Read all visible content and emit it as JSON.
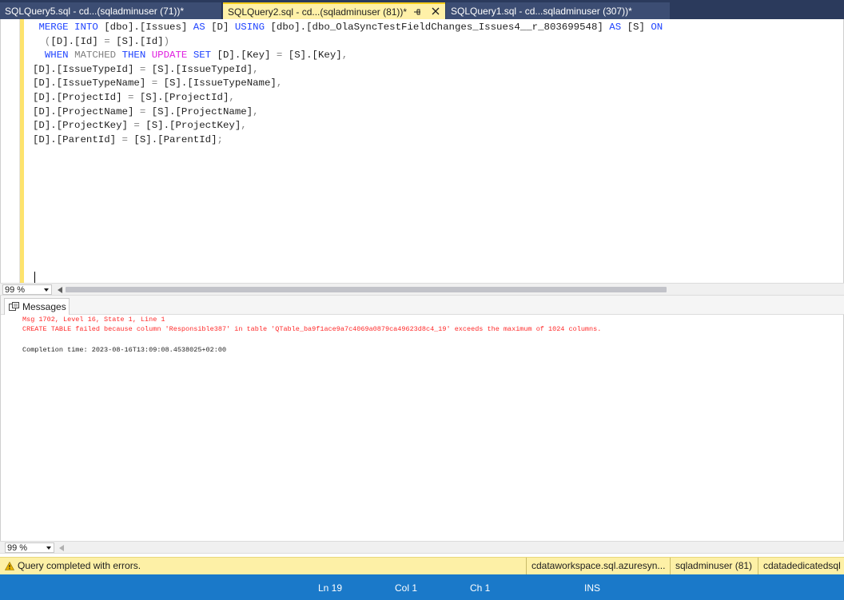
{
  "tabs": [
    {
      "label": "SQLQuery5.sql - cd...(sqladminuser (71))*"
    },
    {
      "label": "SQLQuery2.sql - cd...(sqladminuser (81))*",
      "active": true
    },
    {
      "label": "SQLQuery1.sql - cd...sqladminuser (307))*"
    }
  ],
  "editor": {
    "lines": [
      [
        {
          "t": " ",
          "c": ""
        },
        {
          "t": "MERGE INTO",
          "c": "kw"
        },
        {
          "t": " [dbo].[Issues] ",
          "c": ""
        },
        {
          "t": "AS",
          "c": "kw"
        },
        {
          "t": " [D] ",
          "c": ""
        },
        {
          "t": "USING",
          "c": "kw"
        },
        {
          "t": " [dbo].[dbo_OlaSyncTestFieldChanges_Issues4__r_803699548] ",
          "c": ""
        },
        {
          "t": "AS",
          "c": "kw"
        },
        {
          "t": " [S] ",
          "c": ""
        },
        {
          "t": "ON",
          "c": "kw"
        }
      ],
      [
        {
          "t": "  ",
          "c": ""
        },
        {
          "t": "(",
          "c": "gy"
        },
        {
          "t": "[D].[Id] ",
          "c": ""
        },
        {
          "t": "=",
          "c": "gy"
        },
        {
          "t": " [S].[Id]",
          "c": ""
        },
        {
          "t": ")",
          "c": "gy"
        }
      ],
      [
        {
          "t": "  ",
          "c": ""
        },
        {
          "t": "WHEN",
          "c": "kw"
        },
        {
          "t": " ",
          "c": ""
        },
        {
          "t": "MATCHED",
          "c": "gy"
        },
        {
          "t": " ",
          "c": ""
        },
        {
          "t": "THEN",
          "c": "kw"
        },
        {
          "t": " ",
          "c": ""
        },
        {
          "t": "UPDATE",
          "c": "pk"
        },
        {
          "t": " ",
          "c": ""
        },
        {
          "t": "SET",
          "c": "kw"
        },
        {
          "t": " [D].[Key] ",
          "c": ""
        },
        {
          "t": "=",
          "c": "gy"
        },
        {
          "t": " [S].[Key]",
          "c": ""
        },
        {
          "t": ",",
          "c": "gy"
        }
      ],
      [
        {
          "t": "[D].[IssueTypeId] ",
          "c": ""
        },
        {
          "t": "=",
          "c": "gy"
        },
        {
          "t": " [S].[IssueTypeId]",
          "c": ""
        },
        {
          "t": ",",
          "c": "gy"
        }
      ],
      [
        {
          "t": "[D].[IssueTypeName] ",
          "c": ""
        },
        {
          "t": "=",
          "c": "gy"
        },
        {
          "t": " [S].[IssueTypeName]",
          "c": ""
        },
        {
          "t": ",",
          "c": "gy"
        }
      ],
      [
        {
          "t": "[D].[ProjectId] ",
          "c": ""
        },
        {
          "t": "=",
          "c": "gy"
        },
        {
          "t": " [S].[ProjectId]",
          "c": ""
        },
        {
          "t": ",",
          "c": "gy"
        }
      ],
      [
        {
          "t": "[D].[ProjectName] ",
          "c": ""
        },
        {
          "t": "=",
          "c": "gy"
        },
        {
          "t": " [S].[ProjectName]",
          "c": ""
        },
        {
          "t": ",",
          "c": "gy"
        }
      ],
      [
        {
          "t": "[D].[ProjectKey] ",
          "c": ""
        },
        {
          "t": "=",
          "c": "gy"
        },
        {
          "t": " [S].[ProjectKey]",
          "c": ""
        },
        {
          "t": ",",
          "c": "gy"
        }
      ],
      [
        {
          "t": "[D].[ParentId] ",
          "c": ""
        },
        {
          "t": "=",
          "c": "gy"
        },
        {
          "t": " [S].[ParentId]",
          "c": ""
        },
        {
          "t": ";",
          "c": "gy"
        }
      ]
    ],
    "zoom": "99 %"
  },
  "results": {
    "tab_label": "Messages",
    "zoom": "99 %",
    "messages": {
      "line1": "Msg 1702, Level 16, State 1, Line 1",
      "line2": "CREATE TABLE failed because column 'Responsible387' in table 'QTable_ba9f1ace9a7c4069a0879ca49623d8c4_19' exceeds the maximum of 1024 columns.",
      "completion": "Completion time: 2023-08-16T13:09:08.4538025+02:00"
    }
  },
  "query_status": {
    "text": "Query completed with errors.",
    "server": "cdataworkspace.sql.azuresyn...",
    "user": "sqladminuser (81)",
    "database": "cdatadedicatedsql"
  },
  "status_bar": {
    "ln": "Ln 19",
    "col": "Col 1",
    "ch": "Ch 1",
    "mode": "INS"
  },
  "colors": {
    "tab_strip": "#2b3a5c",
    "active_tab": "#fff1a8",
    "keyword": "#1f43ff",
    "error": "#ff2a2a",
    "status_blue": "#1a79c9",
    "query_status_bg": "#fdf0a6"
  }
}
